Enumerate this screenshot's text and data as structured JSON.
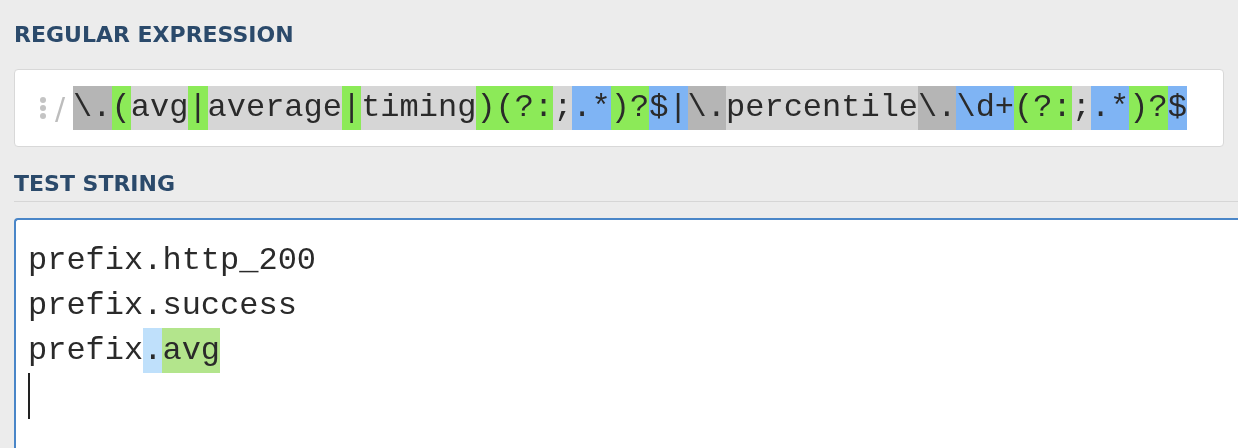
{
  "regex_section": {
    "heading": "REGULAR EXPRESSION",
    "delimiter": "/",
    "tokens": [
      {
        "text": "\\.",
        "kind": "escape"
      },
      {
        "text": "(",
        "kind": "group"
      },
      {
        "text": "avg",
        "kind": "plain"
      },
      {
        "text": "|",
        "kind": "group"
      },
      {
        "text": "average",
        "kind": "plain"
      },
      {
        "text": "|",
        "kind": "group"
      },
      {
        "text": "timing",
        "kind": "plain"
      },
      {
        "text": ")(?:",
        "kind": "group"
      },
      {
        "text": ";",
        "kind": "plain"
      },
      {
        "text": ".*",
        "kind": "quantifier"
      },
      {
        "text": ")?",
        "kind": "group"
      },
      {
        "text": "$|",
        "kind": "quantifier"
      },
      {
        "text": "\\.",
        "kind": "escape"
      },
      {
        "text": "percentile",
        "kind": "plain"
      },
      {
        "text": "\\.",
        "kind": "escape"
      },
      {
        "text": "\\d+",
        "kind": "quantifier"
      },
      {
        "text": "(?:",
        "kind": "group"
      },
      {
        "text": ";",
        "kind": "plain"
      },
      {
        "text": ".*",
        "kind": "quantifier"
      },
      {
        "text": ")?",
        "kind": "group"
      },
      {
        "text": "$",
        "kind": "quantifier"
      }
    ]
  },
  "test_section": {
    "heading": "TEST STRING",
    "lines": [
      [
        {
          "text": "prefix.http_200",
          "kind": "plain"
        }
      ],
      [
        {
          "text": "prefix.success",
          "kind": "plain"
        }
      ],
      [
        {
          "text": "prefix",
          "kind": "plain"
        },
        {
          "text": ".",
          "kind": "match"
        },
        {
          "text": "avg",
          "kind": "group_match"
        }
      ]
    ]
  }
}
